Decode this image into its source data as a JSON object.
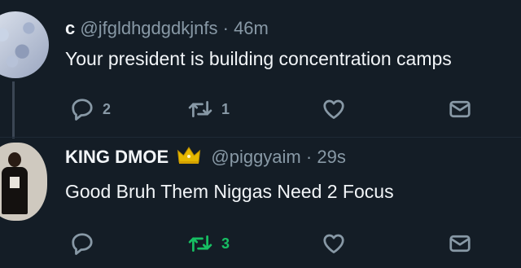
{
  "tweets": [
    {
      "name": "c",
      "handle": "@jfgldhgdgdkjnfs",
      "separator": "·",
      "time": "46m",
      "text": "Your president is building concentration camps",
      "replies": "2",
      "retweets": "1",
      "likes": "",
      "retweeted": false
    },
    {
      "name": "KING DMOE",
      "handle": "@piggyaim",
      "separator": "·",
      "time": "29s",
      "text": "Good Bruh Them Niggas Need 2 Focus",
      "replies": "",
      "retweets": "3",
      "likes": "",
      "retweeted": true
    }
  ],
  "colors": {
    "background": "#141d26",
    "muted": "#8899a6",
    "retweet_active": "#17bf63",
    "crown": "#e6b800"
  },
  "icons": [
    "reply-icon",
    "retweet-icon",
    "like-icon",
    "message-icon",
    "crown-icon"
  ]
}
